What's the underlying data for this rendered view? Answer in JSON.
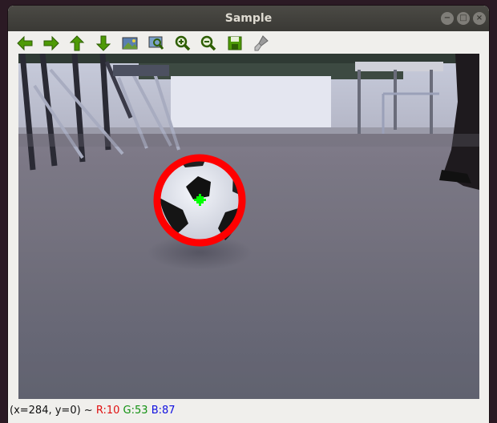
{
  "window": {
    "title": "Sample",
    "controls": {
      "minimize": "−",
      "maximize": "□",
      "close": "×"
    }
  },
  "toolbar": {
    "buttons": [
      {
        "name": "pan-left",
        "icon": "arrow-left-icon"
      },
      {
        "name": "pan-right",
        "icon": "arrow-right-icon"
      },
      {
        "name": "pan-up",
        "icon": "arrow-up-icon"
      },
      {
        "name": "pan-down",
        "icon": "arrow-down-icon"
      },
      {
        "name": "zoom-original",
        "icon": "image-icon"
      },
      {
        "name": "zoom-fit",
        "icon": "zoom-fit-icon"
      },
      {
        "name": "zoom-in",
        "icon": "zoom-in-icon"
      },
      {
        "name": "zoom-out",
        "icon": "zoom-out-icon"
      },
      {
        "name": "save",
        "icon": "save-icon"
      },
      {
        "name": "properties",
        "icon": "brush-icon"
      }
    ]
  },
  "status": {
    "coords": "(x=284, y=0) ~",
    "r": "R:10",
    "g": "G:53",
    "b": "B:87"
  },
  "colors": {
    "circle": "#ff0000",
    "center": "#00ff00",
    "icon_green": "#4e9a06"
  }
}
